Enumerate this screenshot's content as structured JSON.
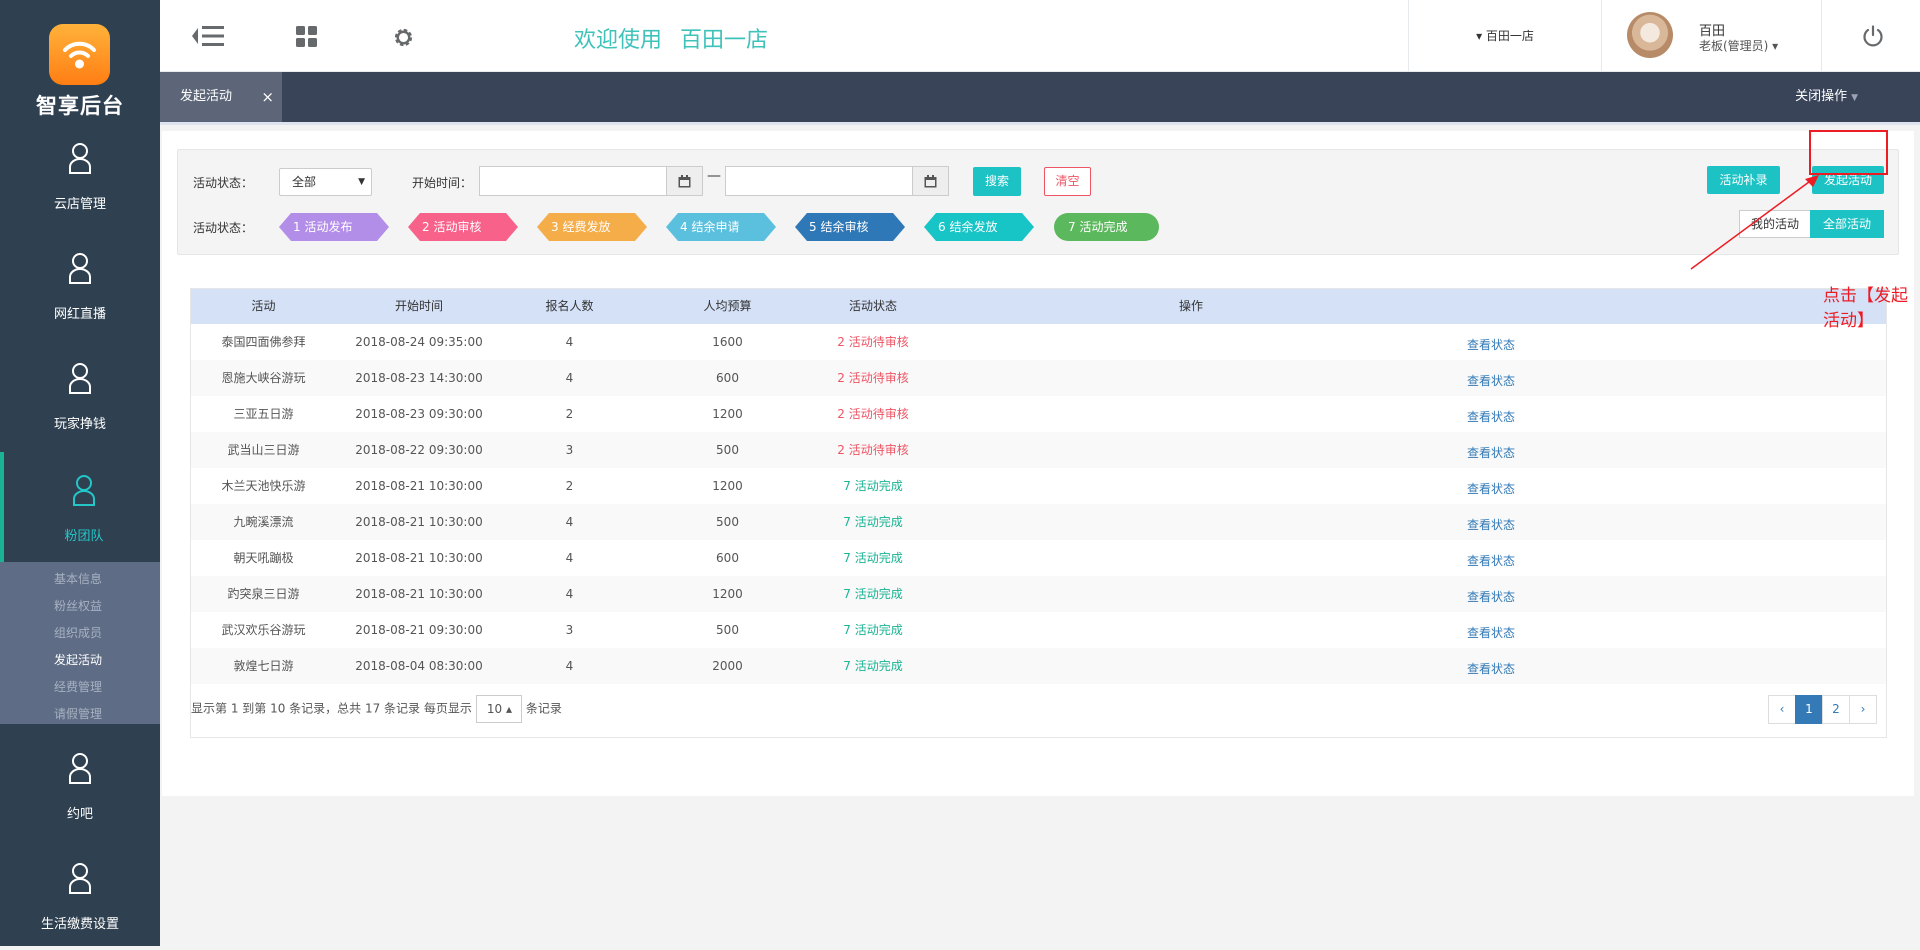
{
  "brand": {
    "name": "智享后台"
  },
  "sidebar": {
    "items": [
      {
        "label": "云店管理"
      },
      {
        "label": "网红直播"
      },
      {
        "label": "玩家挣钱"
      },
      {
        "label": "粉团队"
      },
      {
        "label": "约吧"
      },
      {
        "label": "生活缴费设置"
      }
    ],
    "subitems": [
      "基本信息",
      "粉丝权益",
      "组织成员",
      "发起活动",
      "经费管理",
      "请假管理"
    ]
  },
  "header": {
    "welcome": "欢迎使用",
    "store_title": "百田一店",
    "store_selector": "▾ 百田一店",
    "user_name": "百田",
    "user_role": "老板(管理员) ▾"
  },
  "tabbar": {
    "tab_label": "发起活动",
    "close_symbol": "×",
    "close_ops": "关闭操作"
  },
  "filter": {
    "status_label": "活动状态：",
    "status_value": "全部",
    "start_label": "开始时间：",
    "dash": "—",
    "search": "搜索",
    "clear": "清空",
    "progress_label": "活动状态：",
    "steps": [
      "1 活动发布",
      "2 活动审核",
      "3 经费发放",
      "4 结余申请",
      "5 结余审核",
      "6 结余发放",
      "7 活动完成"
    ],
    "supplement": "活动补录",
    "launch": "发起活动",
    "my_activity": "我的活动",
    "all_activity": "全部活动"
  },
  "annotation": "点击【发起活动】",
  "table": {
    "headers": [
      "活动",
      "开始时间",
      "报名人数",
      "人均预算",
      "活动状态",
      "操作"
    ],
    "rows": [
      [
        "泰国四面佛参拜",
        "2018-08-24 09:35:00",
        "4",
        "1600",
        "2 活动待审核",
        "查看状态"
      ],
      [
        "恩施大峡谷游玩",
        "2018-08-23 14:30:00",
        "4",
        "600",
        "2 活动待审核",
        "查看状态"
      ],
      [
        "三亚五日游",
        "2018-08-23 09:30:00",
        "2",
        "1200",
        "2 活动待审核",
        "查看状态"
      ],
      [
        "武当山三日游",
        "2018-08-22 09:30:00",
        "3",
        "500",
        "2 活动待审核",
        "查看状态"
      ],
      [
        "木兰天池快乐游",
        "2018-08-21 10:30:00",
        "2",
        "1200",
        "7 活动完成",
        "查看状态"
      ],
      [
        "九畹溪漂流",
        "2018-08-21 10:30:00",
        "4",
        "500",
        "7 活动完成",
        "查看状态"
      ],
      [
        "朝天吼蹦极",
        "2018-08-21 10:30:00",
        "4",
        "600",
        "7 活动完成",
        "查看状态"
      ],
      [
        "趵突泉三日游",
        "2018-08-21 10:30:00",
        "4",
        "1200",
        "7 活动完成",
        "查看状态"
      ],
      [
        "武汉欢乐谷游玩",
        "2018-08-21 09:30:00",
        "3",
        "500",
        "7 活动完成",
        "查看状态"
      ],
      [
        "敦煌七日游",
        "2018-08-04 08:30:00",
        "4",
        "2000",
        "7 活动完成",
        "查看状态"
      ]
    ],
    "info_prefix": "显示第 1 到第 10 条记录，总共 17 条记录 每页显示",
    "page_size": "10 ▴",
    "info_suffix": "条记录",
    "pager": [
      "‹",
      "1",
      "2",
      "›"
    ]
  },
  "colors": {
    "teal": "#1cc2c4",
    "sidebar": "#2f4050",
    "pending": "#ed5565",
    "done": "#1ab394"
  }
}
